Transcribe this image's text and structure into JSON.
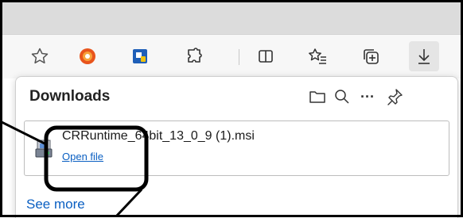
{
  "browser": {
    "toolbar": {
      "icons": [
        "star-outline-icon",
        "extension-orange-icon",
        "blue-app-icon",
        "puzzle-icon",
        "split-screen-icon",
        "favorites-icon",
        "collections-icon",
        "download-icon"
      ]
    }
  },
  "downloads": {
    "title": "Downloads",
    "header_icons": [
      "folder-icon",
      "search-icon",
      "more-icon",
      "pin-icon"
    ],
    "more_label": "···",
    "items": [
      {
        "file_name": "CRRuntime_64bit_13_0_9 (1).msi",
        "action_label": "Open file",
        "icon": "installer-icon"
      }
    ],
    "see_more_label": "See more"
  },
  "colors": {
    "link": "#0a5fc2",
    "annotation": "#000000",
    "titlebar": "#dcdcdc",
    "toolbar": "#f7f7f7"
  }
}
